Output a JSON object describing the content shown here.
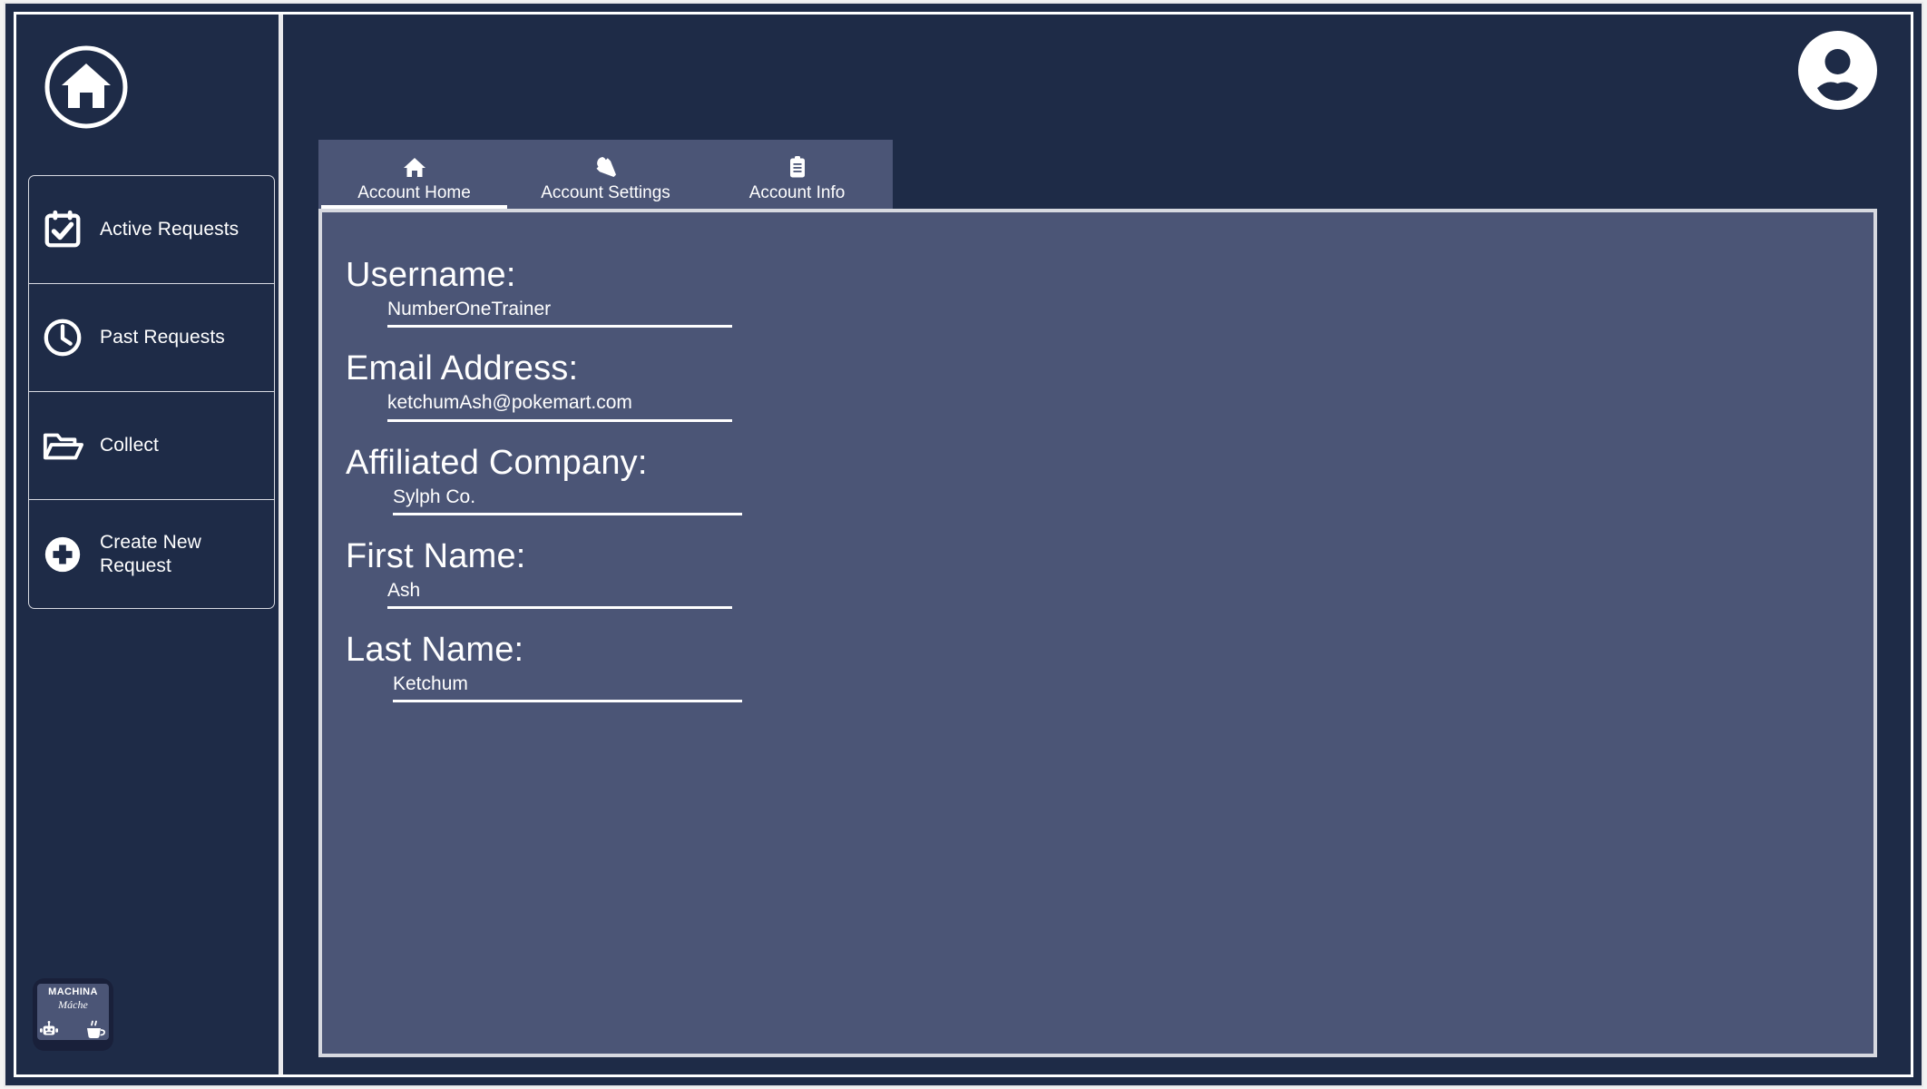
{
  "app": {
    "background_color": "#1e2b47",
    "panel_color": "#4b5576",
    "accent_color": "#ffffff"
  },
  "sidebar": {
    "home_logo": {
      "icon": "home-icon",
      "label": "Home"
    },
    "items": [
      {
        "icon": "calendar-check-icon",
        "label": "Active Requests"
      },
      {
        "icon": "clock-icon",
        "label": "Past Requests"
      },
      {
        "icon": "folder-open-icon",
        "label": "Collect"
      },
      {
        "icon": "plus-circle-icon",
        "label": "Create New Request"
      }
    ],
    "brand": {
      "top": "MACHINA",
      "sub": "Máche",
      "left_icon": "robot-icon",
      "right_icon": "coffee-cup-icon"
    }
  },
  "header": {
    "avatar_icon": "account-circle-icon"
  },
  "main": {
    "tabs": [
      {
        "icon": "home-icon",
        "label": "Account Home",
        "active": true
      },
      {
        "icon": "wrench-icon",
        "label": "Account Settings",
        "active": false
      },
      {
        "icon": "clipboard-icon",
        "label": "Account Info",
        "active": false
      }
    ],
    "form": {
      "fields": [
        {
          "label": "Username:",
          "value": "NumberOneTrainer"
        },
        {
          "label": "Email Address:",
          "value": "ketchumAsh@pokemart.com"
        },
        {
          "label": "Affiliated Company:",
          "value": "Sylph Co."
        },
        {
          "label": "First Name:",
          "value": "Ash"
        },
        {
          "label": "Last Name:",
          "value": "Ketchum"
        }
      ]
    }
  }
}
